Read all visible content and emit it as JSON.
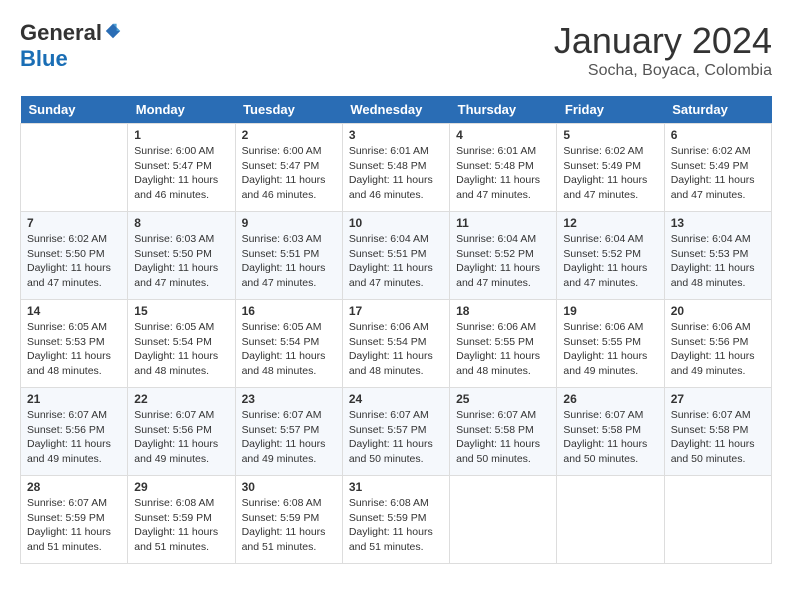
{
  "header": {
    "logo_general": "General",
    "logo_blue": "Blue",
    "month_title": "January 2024",
    "subtitle": "Socha, Boyaca, Colombia"
  },
  "days_of_week": [
    "Sunday",
    "Monday",
    "Tuesday",
    "Wednesday",
    "Thursday",
    "Friday",
    "Saturday"
  ],
  "weeks": [
    [
      {
        "day": "",
        "info": ""
      },
      {
        "day": "1",
        "info": "Sunrise: 6:00 AM\nSunset: 5:47 PM\nDaylight: 11 hours\nand 46 minutes."
      },
      {
        "day": "2",
        "info": "Sunrise: 6:00 AM\nSunset: 5:47 PM\nDaylight: 11 hours\nand 46 minutes."
      },
      {
        "day": "3",
        "info": "Sunrise: 6:01 AM\nSunset: 5:48 PM\nDaylight: 11 hours\nand 46 minutes."
      },
      {
        "day": "4",
        "info": "Sunrise: 6:01 AM\nSunset: 5:48 PM\nDaylight: 11 hours\nand 47 minutes."
      },
      {
        "day": "5",
        "info": "Sunrise: 6:02 AM\nSunset: 5:49 PM\nDaylight: 11 hours\nand 47 minutes."
      },
      {
        "day": "6",
        "info": "Sunrise: 6:02 AM\nSunset: 5:49 PM\nDaylight: 11 hours\nand 47 minutes."
      }
    ],
    [
      {
        "day": "7",
        "info": "Sunrise: 6:02 AM\nSunset: 5:50 PM\nDaylight: 11 hours\nand 47 minutes."
      },
      {
        "day": "8",
        "info": "Sunrise: 6:03 AM\nSunset: 5:50 PM\nDaylight: 11 hours\nand 47 minutes."
      },
      {
        "day": "9",
        "info": "Sunrise: 6:03 AM\nSunset: 5:51 PM\nDaylight: 11 hours\nand 47 minutes."
      },
      {
        "day": "10",
        "info": "Sunrise: 6:04 AM\nSunset: 5:51 PM\nDaylight: 11 hours\nand 47 minutes."
      },
      {
        "day": "11",
        "info": "Sunrise: 6:04 AM\nSunset: 5:52 PM\nDaylight: 11 hours\nand 47 minutes."
      },
      {
        "day": "12",
        "info": "Sunrise: 6:04 AM\nSunset: 5:52 PM\nDaylight: 11 hours\nand 47 minutes."
      },
      {
        "day": "13",
        "info": "Sunrise: 6:04 AM\nSunset: 5:53 PM\nDaylight: 11 hours\nand 48 minutes."
      }
    ],
    [
      {
        "day": "14",
        "info": "Sunrise: 6:05 AM\nSunset: 5:53 PM\nDaylight: 11 hours\nand 48 minutes."
      },
      {
        "day": "15",
        "info": "Sunrise: 6:05 AM\nSunset: 5:54 PM\nDaylight: 11 hours\nand 48 minutes."
      },
      {
        "day": "16",
        "info": "Sunrise: 6:05 AM\nSunset: 5:54 PM\nDaylight: 11 hours\nand 48 minutes."
      },
      {
        "day": "17",
        "info": "Sunrise: 6:06 AM\nSunset: 5:54 PM\nDaylight: 11 hours\nand 48 minutes."
      },
      {
        "day": "18",
        "info": "Sunrise: 6:06 AM\nSunset: 5:55 PM\nDaylight: 11 hours\nand 48 minutes."
      },
      {
        "day": "19",
        "info": "Sunrise: 6:06 AM\nSunset: 5:55 PM\nDaylight: 11 hours\nand 49 minutes."
      },
      {
        "day": "20",
        "info": "Sunrise: 6:06 AM\nSunset: 5:56 PM\nDaylight: 11 hours\nand 49 minutes."
      }
    ],
    [
      {
        "day": "21",
        "info": "Sunrise: 6:07 AM\nSunset: 5:56 PM\nDaylight: 11 hours\nand 49 minutes."
      },
      {
        "day": "22",
        "info": "Sunrise: 6:07 AM\nSunset: 5:56 PM\nDaylight: 11 hours\nand 49 minutes."
      },
      {
        "day": "23",
        "info": "Sunrise: 6:07 AM\nSunset: 5:57 PM\nDaylight: 11 hours\nand 49 minutes."
      },
      {
        "day": "24",
        "info": "Sunrise: 6:07 AM\nSunset: 5:57 PM\nDaylight: 11 hours\nand 50 minutes."
      },
      {
        "day": "25",
        "info": "Sunrise: 6:07 AM\nSunset: 5:58 PM\nDaylight: 11 hours\nand 50 minutes."
      },
      {
        "day": "26",
        "info": "Sunrise: 6:07 AM\nSunset: 5:58 PM\nDaylight: 11 hours\nand 50 minutes."
      },
      {
        "day": "27",
        "info": "Sunrise: 6:07 AM\nSunset: 5:58 PM\nDaylight: 11 hours\nand 50 minutes."
      }
    ],
    [
      {
        "day": "28",
        "info": "Sunrise: 6:07 AM\nSunset: 5:59 PM\nDaylight: 11 hours\nand 51 minutes."
      },
      {
        "day": "29",
        "info": "Sunrise: 6:08 AM\nSunset: 5:59 PM\nDaylight: 11 hours\nand 51 minutes."
      },
      {
        "day": "30",
        "info": "Sunrise: 6:08 AM\nSunset: 5:59 PM\nDaylight: 11 hours\nand 51 minutes."
      },
      {
        "day": "31",
        "info": "Sunrise: 6:08 AM\nSunset: 5:59 PM\nDaylight: 11 hours\nand 51 minutes."
      },
      {
        "day": "",
        "info": ""
      },
      {
        "day": "",
        "info": ""
      },
      {
        "day": "",
        "info": ""
      }
    ]
  ]
}
